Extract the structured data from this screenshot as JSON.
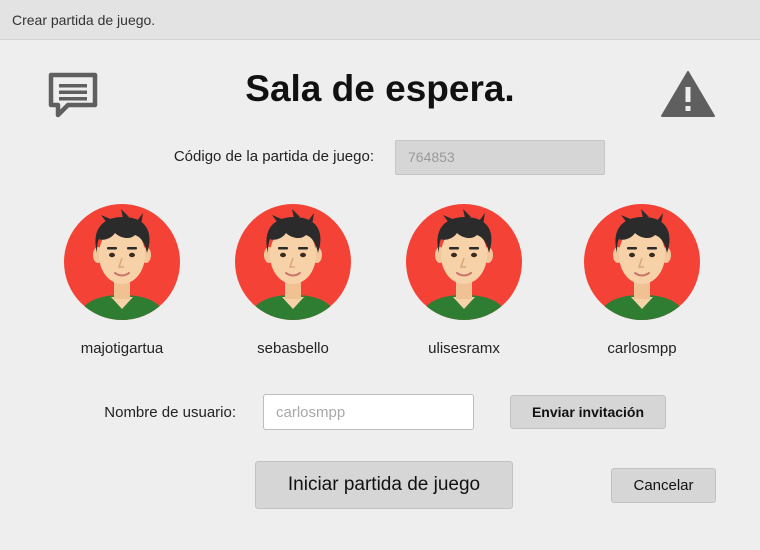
{
  "window": {
    "title": "Crear partida de juego."
  },
  "header": {
    "title": "Sala de espera.",
    "left_icon": "chat-message-icon",
    "right_icon": "warning-icon"
  },
  "game_code": {
    "label": "Código de la partida de juego:",
    "value": "764853"
  },
  "players": [
    {
      "name": "majotigartua"
    },
    {
      "name": "sebasbello"
    },
    {
      "name": "ulisesramx"
    },
    {
      "name": "carlosmpp"
    }
  ],
  "invite": {
    "label": "Nombre de usuario:",
    "placeholder": "carlosmpp",
    "button_label": "Enviar invitación"
  },
  "actions": {
    "start_label": "Iniciar partida de juego",
    "cancel_label": "Cancelar"
  },
  "colors": {
    "avatar_background": "#F44336",
    "hair": "#2b2b2b",
    "skin": "#F7D2A8",
    "shirt": "#2E7D32",
    "icon_gray": "#5f5f5f"
  }
}
